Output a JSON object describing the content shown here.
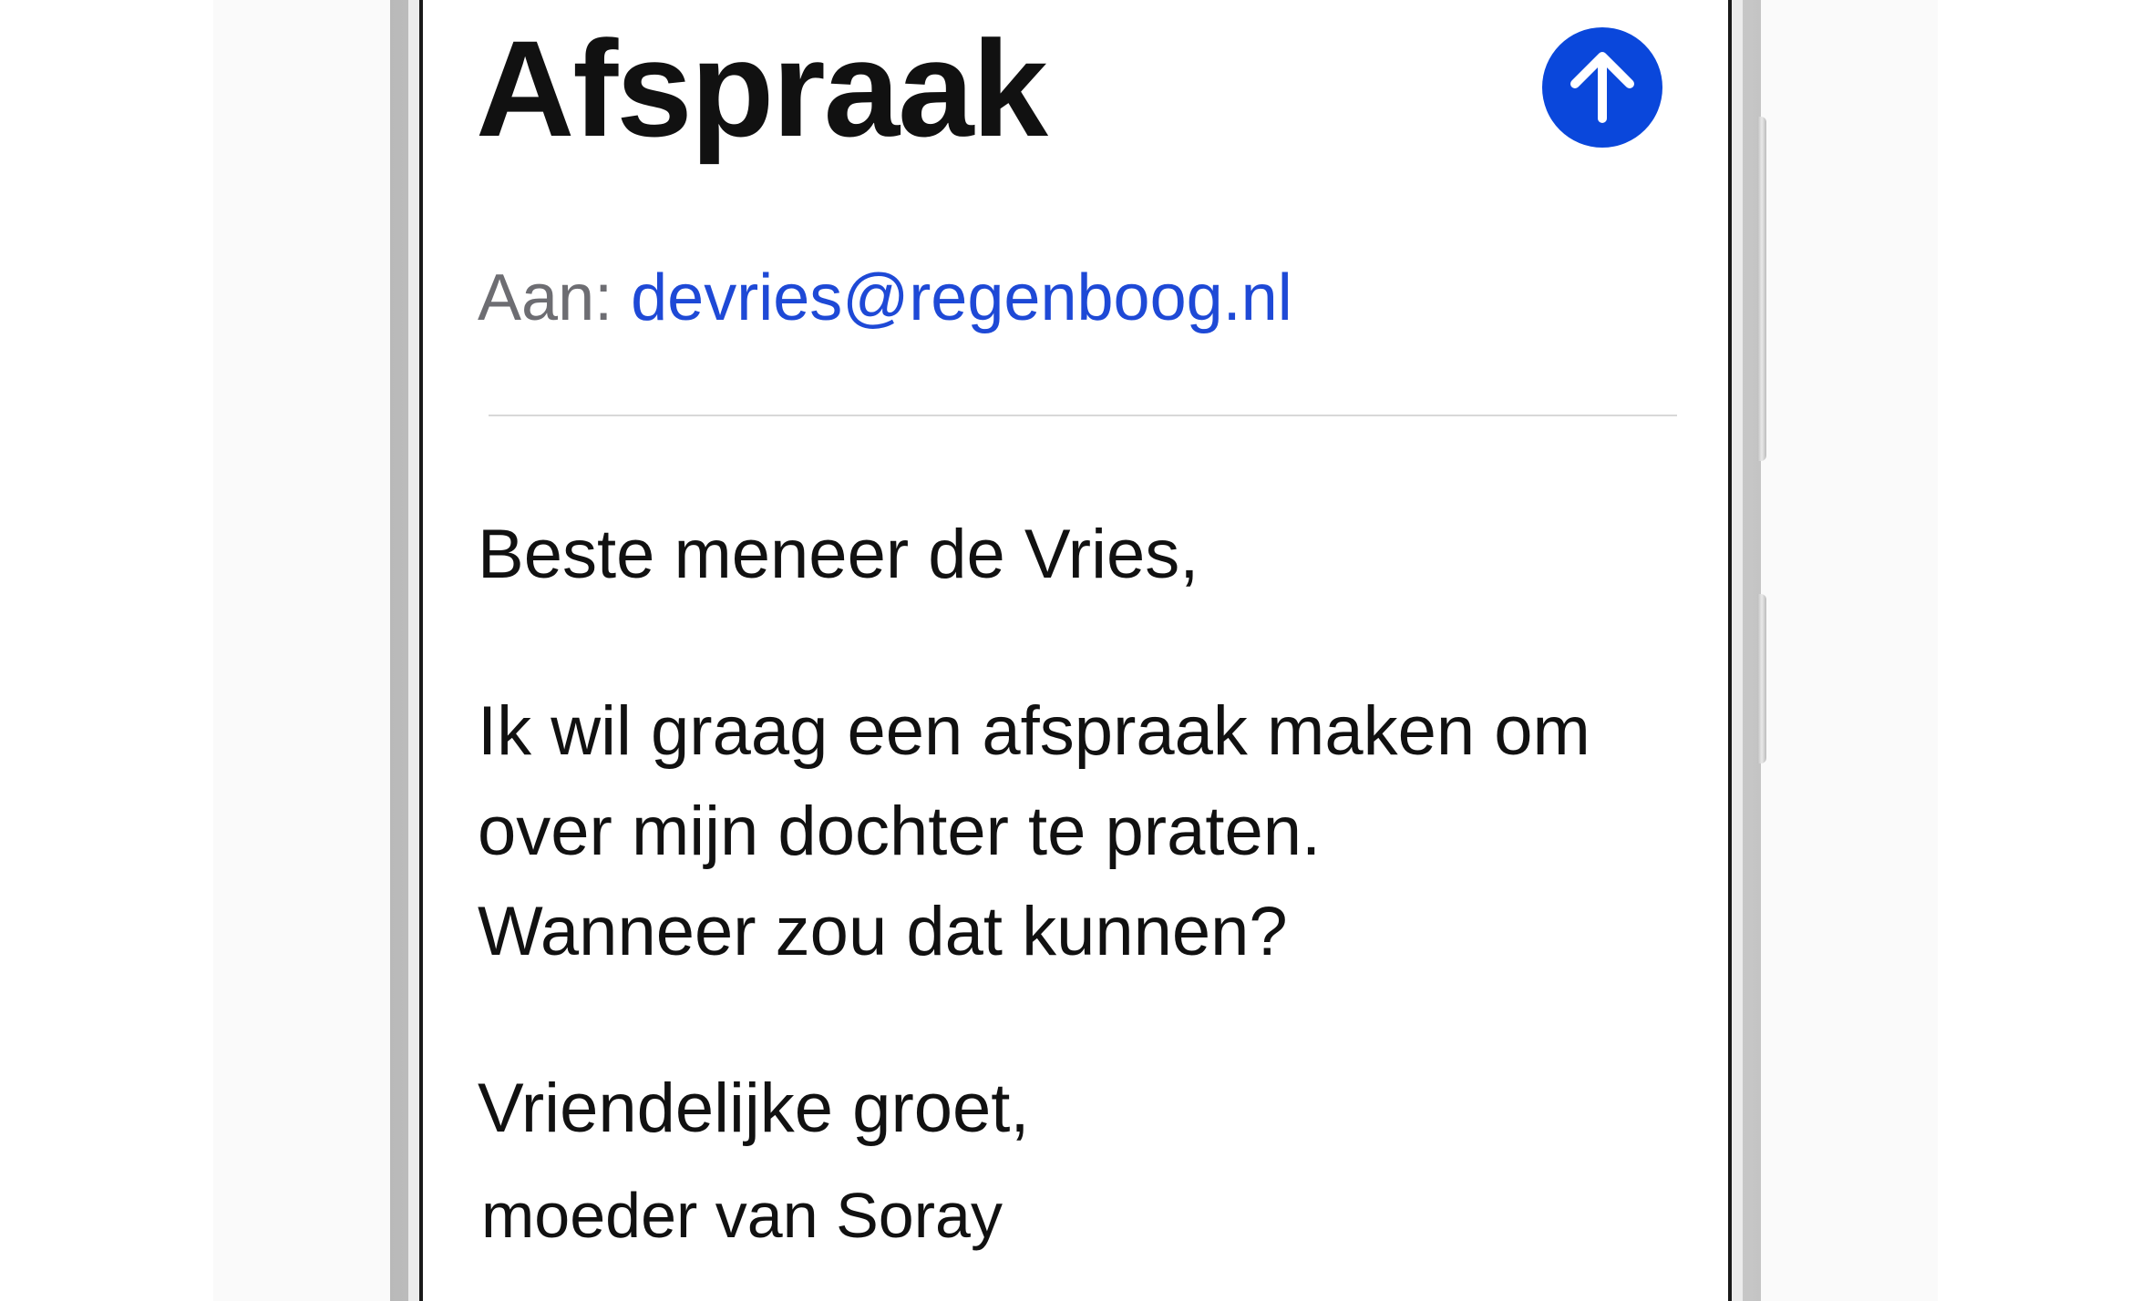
{
  "email": {
    "subject": "Afspraak",
    "to_label": "Aan:",
    "to_address": "devries@regenboog.nl",
    "greeting": "Beste meneer de Vries,",
    "body_lines": [
      "Ik wil graag een afspraak maken om",
      "over mijn dochter te praten.",
      "Wanneer zou dat kunnen?"
    ],
    "closing": "Vriendelijke groet,",
    "signature": "moeder van Soray"
  },
  "send_button": {
    "icon": "arrow-up-icon"
  },
  "colors": {
    "send_button": "#0a47db",
    "link": "#1e49d6",
    "label_gray": "#6d6d72",
    "text": "#111111"
  }
}
